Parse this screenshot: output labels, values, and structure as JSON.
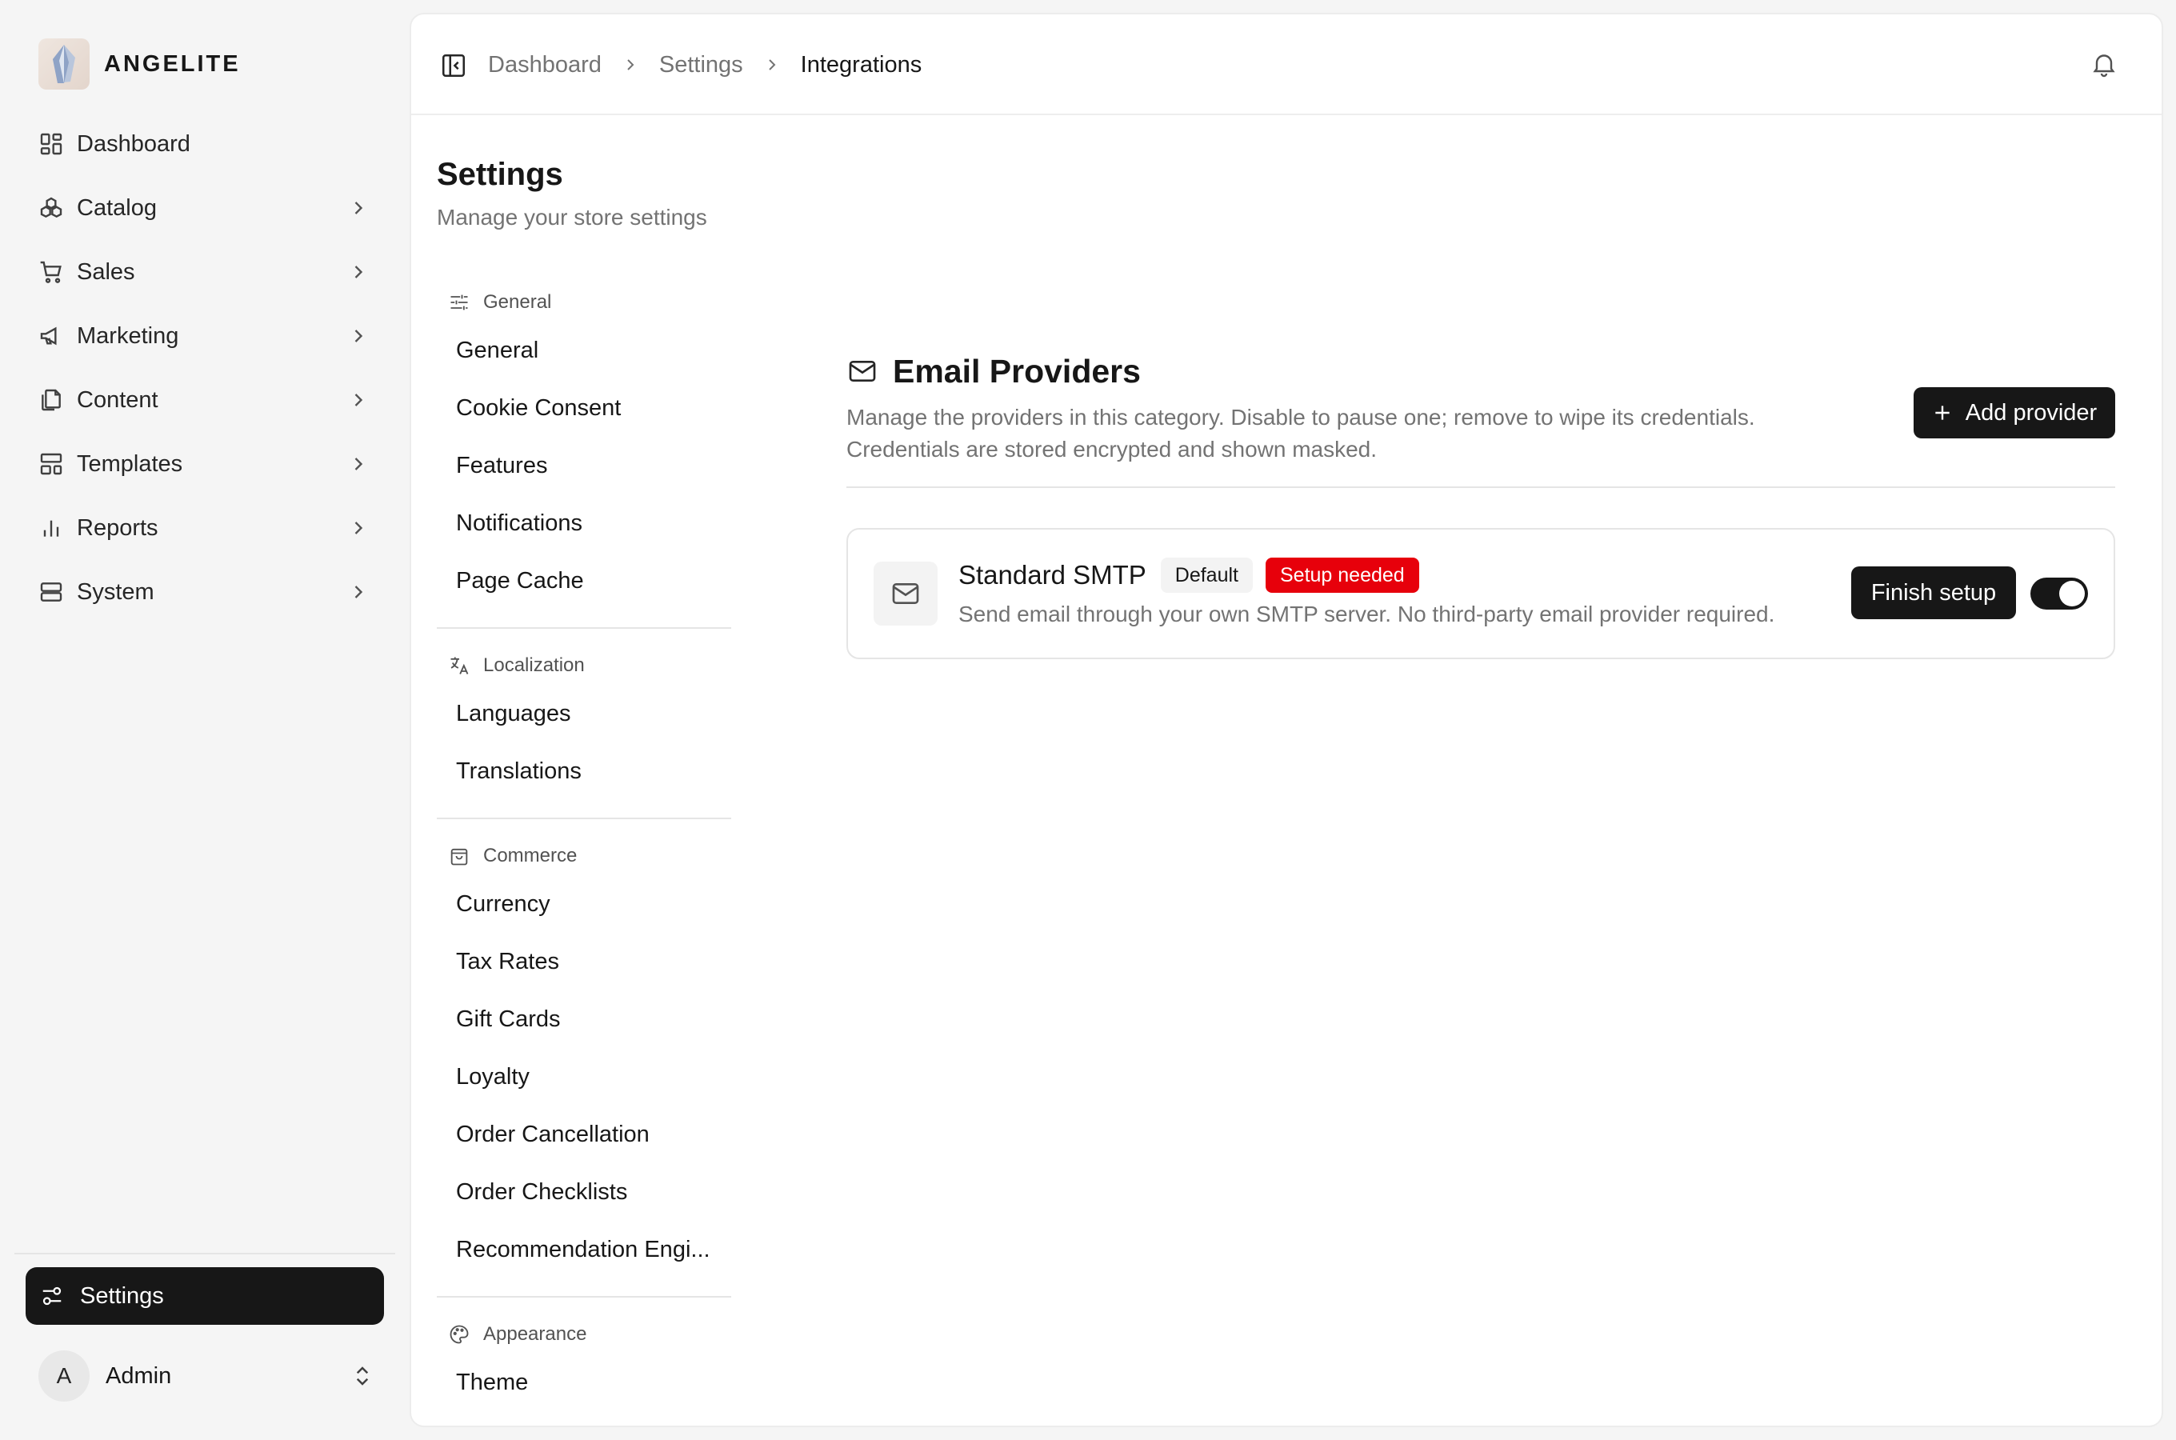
{
  "brand": {
    "name": "ANGELITE"
  },
  "sidebar": {
    "items": [
      {
        "label": "Dashboard",
        "icon": "dashboard-icon",
        "has_chevron": false
      },
      {
        "label": "Catalog",
        "icon": "catalog-icon",
        "has_chevron": true
      },
      {
        "label": "Sales",
        "icon": "cart-icon",
        "has_chevron": true
      },
      {
        "label": "Marketing",
        "icon": "megaphone-icon",
        "has_chevron": true
      },
      {
        "label": "Content",
        "icon": "files-icon",
        "has_chevron": true
      },
      {
        "label": "Templates",
        "icon": "templates-icon",
        "has_chevron": true
      },
      {
        "label": "Reports",
        "icon": "chart-icon",
        "has_chevron": true
      },
      {
        "label": "System",
        "icon": "server-icon",
        "has_chevron": true
      }
    ],
    "active_item": {
      "label": "Settings",
      "icon": "settings-sliders-icon"
    },
    "user": {
      "initial": "A",
      "name": "Admin"
    }
  },
  "breadcrumb": {
    "items": [
      "Dashboard",
      "Settings",
      "Integrations"
    ]
  },
  "page": {
    "title": "Settings",
    "subtitle": "Manage your store settings"
  },
  "subnav": {
    "general": {
      "heading": "General",
      "items": [
        "General",
        "Cookie Consent",
        "Features",
        "Notifications",
        "Page Cache"
      ]
    },
    "localization": {
      "heading": "Localization",
      "items": [
        "Languages",
        "Translations"
      ]
    },
    "commerce": {
      "heading": "Commerce",
      "items": [
        "Currency",
        "Tax Rates",
        "Gift Cards",
        "Loyalty",
        "Order Cancellation",
        "Order Checklists",
        "Recommendation Engi..."
      ]
    },
    "appearance": {
      "heading": "Appearance",
      "items": [
        "Theme"
      ]
    }
  },
  "section": {
    "title": "Email Providers",
    "description_line1": "Manage the providers in this category. Disable to pause one; remove to wipe its credentials.",
    "description_line2": "Credentials are stored encrypted and shown masked.",
    "add_button": "Add provider"
  },
  "provider": {
    "name": "Standard SMTP",
    "badge_default": "Default",
    "badge_status": "Setup needed",
    "description": "Send email through your own SMTP server. No third-party email provider required.",
    "action_button": "Finish setup",
    "enabled": true
  },
  "colors": {
    "primary": "#171717",
    "danger": "#e7000b",
    "muted_text": "#737373"
  }
}
